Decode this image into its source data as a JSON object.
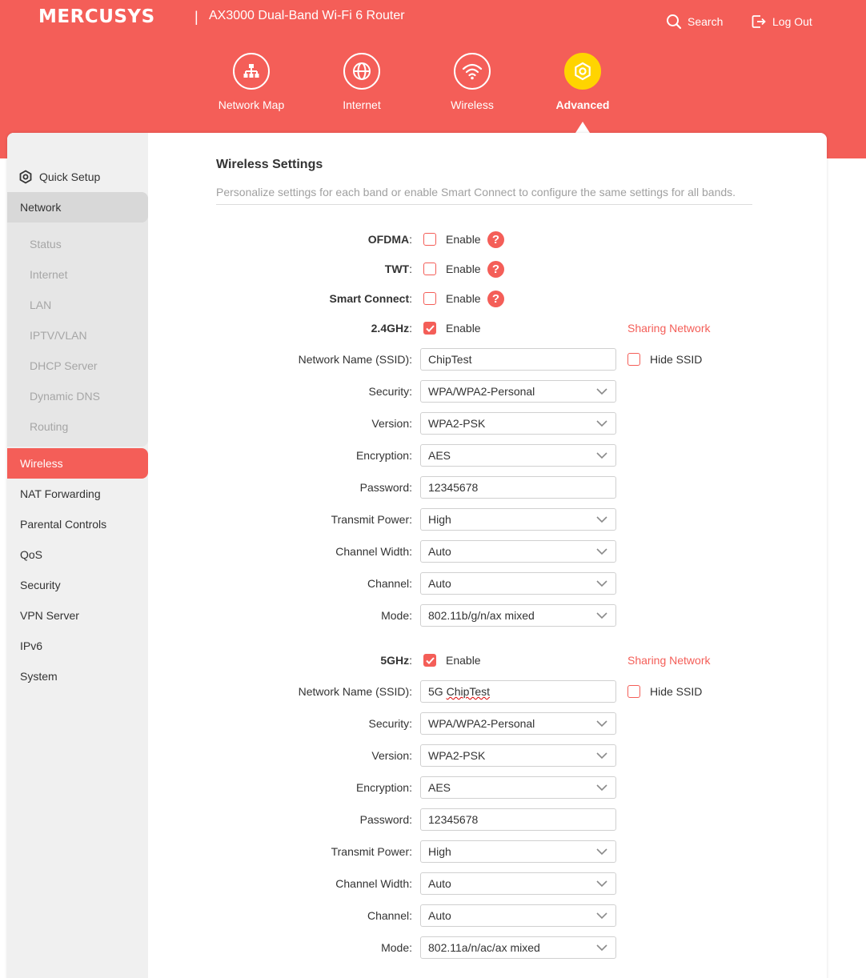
{
  "header": {
    "brand": "MERCUSYS",
    "separator": "|",
    "product": "AX3000 Dual-Band Wi-Fi 6 Router",
    "search_label": "Search",
    "logout_label": "Log Out"
  },
  "nav": {
    "network_map": "Network Map",
    "internet": "Internet",
    "wireless": "Wireless",
    "advanced": "Advanced"
  },
  "sidebar": {
    "quick_setup": "Quick Setup",
    "network": "Network",
    "status": "Status",
    "internet": "Internet",
    "lan": "LAN",
    "iptv_vlan": "IPTV/VLAN",
    "dhcp_server": "DHCP Server",
    "dynamic_dns": "Dynamic DNS",
    "routing": "Routing",
    "wireless": "Wireless",
    "nat_forwarding": "NAT Forwarding",
    "parental_controls": "Parental Controls",
    "qos": "QoS",
    "security": "Security",
    "vpn_server": "VPN Server",
    "ipv6": "IPv6",
    "system": "System"
  },
  "section": {
    "title": "Wireless Settings",
    "description": "Personalize settings for each band or enable Smart Connect to configure the same settings for all bands."
  },
  "common": {
    "enable": "Enable",
    "help": "?",
    "colon": ":",
    "sharing_network": "Sharing Network",
    "hide_ssid": "Hide SSID"
  },
  "general": {
    "ofdma_label": "OFDMA",
    "ofdma_checked": false,
    "twt_label": "TWT",
    "twt_checked": false,
    "smart_connect_label": "Smart Connect",
    "smart_connect_checked": false
  },
  "labels": {
    "ssid": "Network Name (SSID):",
    "security": "Security:",
    "version": "Version:",
    "encryption": "Encryption:",
    "password": "Password:",
    "transmit_power": "Transmit Power:",
    "channel_width": "Channel Width:",
    "channel": "Channel:",
    "mode": "Mode:"
  },
  "band24": {
    "label": "2.4GHz",
    "enabled": true,
    "hide_ssid": false,
    "ssid": "ChipTest",
    "security": "WPA/WPA2-Personal",
    "version": "WPA2-PSK",
    "encryption": "AES",
    "password": "12345678",
    "transmit_power": "High",
    "channel_width": "Auto",
    "channel": "Auto",
    "mode": "802.11b/g/n/ax mixed"
  },
  "band5": {
    "label": "5GHz",
    "enabled": true,
    "hide_ssid": false,
    "ssid_prefix": "5G ",
    "ssid_word": "ChipTest",
    "security": "WPA/WPA2-Personal",
    "version": "WPA2-PSK",
    "encryption": "AES",
    "password": "12345678",
    "transmit_power": "High",
    "channel_width": "Auto",
    "channel": "Auto",
    "mode": "802.11a/n/ac/ax mixed"
  },
  "colors": {
    "brand_red": "#f45e58",
    "active_yellow": "#ffd400",
    "sidebar_bg": "#f0f0f0"
  },
  "icons": {
    "network_map": "network-map-icon",
    "internet": "globe-icon",
    "wireless": "wifi-icon",
    "advanced": "gear-icon",
    "search": "search-icon",
    "logout": "logout-icon",
    "quick_setup": "gear-icon",
    "select": "chevron-down-icon",
    "help": "help-icon",
    "check": "checkmark-icon"
  }
}
